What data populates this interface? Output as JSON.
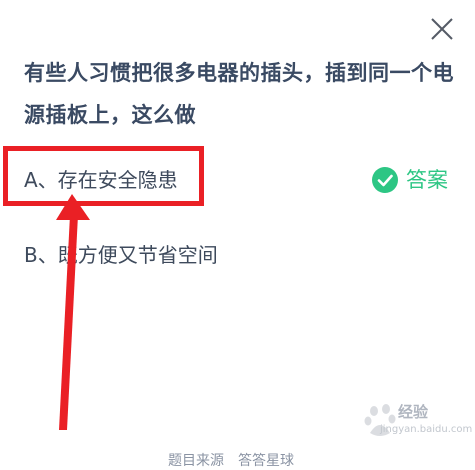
{
  "question": {
    "text": "有些人习惯把很多电器的插头，插到同一个电源插板上，这么做"
  },
  "options": [
    {
      "label": "A、存在安全隐患"
    },
    {
      "label": "B、既方便又节省空间"
    }
  ],
  "answer": {
    "label": "答案",
    "icon": "check-circle-icon",
    "color": "#2dc684"
  },
  "footer": {
    "text": "题目来源　答答星球"
  },
  "watermark": {
    "brand": "经验",
    "sub": "jingyan.baidu.com"
  },
  "colors": {
    "highlight": "#ea2025",
    "question_text": "#3a4a63",
    "option_text": "#3e4a5c"
  }
}
